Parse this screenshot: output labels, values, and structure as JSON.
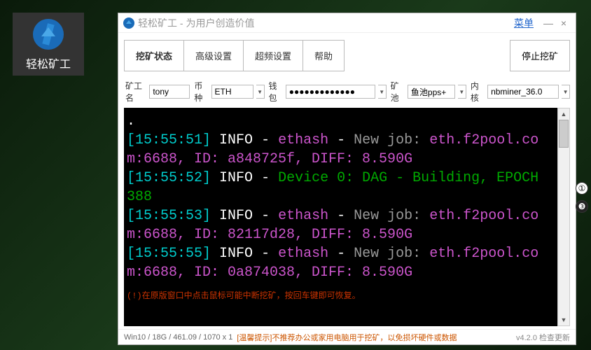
{
  "desktop": {
    "icon_label": "轻松矿工"
  },
  "titlebar": {
    "title": "轻松矿工 - 为用户创造价值",
    "menu": "菜单",
    "minimize": "—",
    "close": "×"
  },
  "tabs": {
    "mining_status": "挖矿状态",
    "advanced": "高级设置",
    "overclock": "超频设置",
    "help": "帮助",
    "stop": "停止挖矿"
  },
  "form": {
    "worker_label": "矿工名",
    "worker_value": "tony",
    "coin_label": "币种",
    "coin_value": "ETH",
    "wallet_label": "钱包",
    "wallet_value": "●●●●●●●●●●●●●",
    "pool_label": "矿池",
    "pool_value": "鱼池pps+",
    "kernel_label": "内核",
    "kernel_value": "nbminer_36.0"
  },
  "console": {
    "lines": [
      {
        "ts": "[15:55:51]",
        "lvl": "INFO",
        "cat": "ethash",
        "rest": "New job: eth.f2pool.com:6688, ID: a848725f, DIFF: 8.590G"
      },
      {
        "ts": "[15:55:52]",
        "lvl": "INFO",
        "dev": "Device 0: DAG - Building, EPOCH 388"
      },
      {
        "ts": "[15:55:53]",
        "lvl": "INFO",
        "cat": "ethash",
        "rest": "New job: eth.f2pool.com:6688, ID: 82117d28, DIFF: 8.590G"
      },
      {
        "ts": "[15:55:55]",
        "lvl": "INFO",
        "cat": "ethash",
        "rest": "New job: eth.f2pool.com:6688, ID: 0a874038, DIFF: 8.590G"
      }
    ],
    "warning": "(!)在原版窗口中点击鼠标可能中断挖矿，按回车键即可恢复。"
  },
  "statusbar": {
    "sys": "Win10  /  18G / 461.09  /  1070 x 1",
    "tip": "[温馨提示]不推荐办公或家用电脑用于挖矿，以免损坏硬件或数据",
    "version": "v4.2.0 检查更新"
  },
  "side": {
    "b1": "①",
    "b2": "❸"
  }
}
